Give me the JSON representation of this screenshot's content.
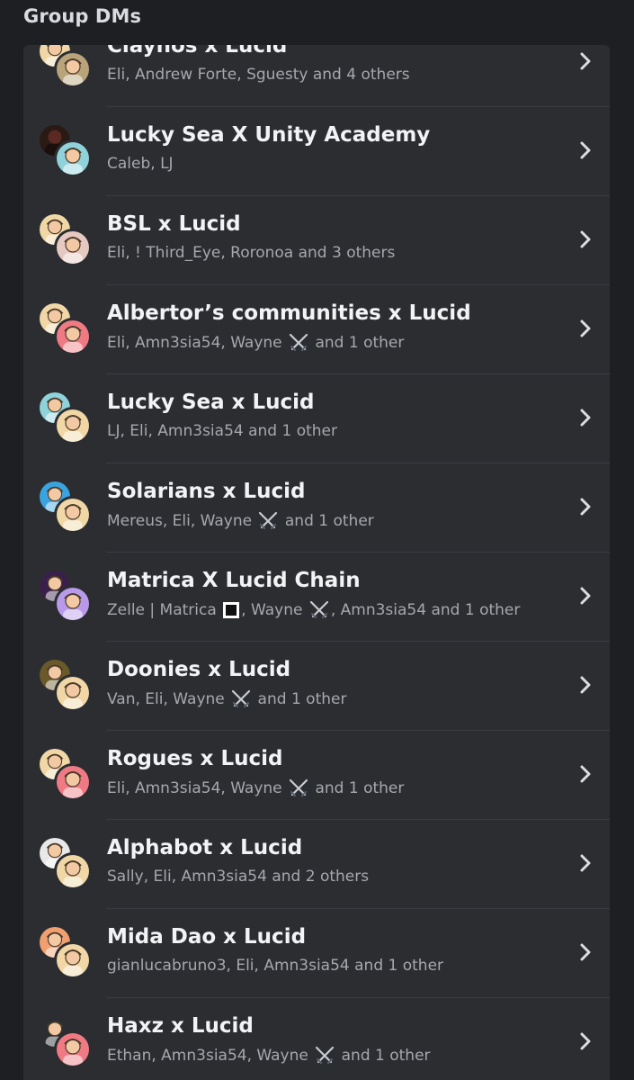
{
  "section_title": "Group DMs",
  "rows": [
    {
      "title": "Claynos x Lucid",
      "sub_parts": [
        "Eli, Andrew Forte, Sguesty and 4 others"
      ],
      "avatar_back": "#f0d7a5",
      "avatar_front": "#b8a37a",
      "avatar_back_icon": "person-sketch-icon",
      "avatar_front_icon": "bird-icon"
    },
    {
      "title": "Lucky Sea X Unity Academy",
      "sub_parts": [
        "Caleb, LJ"
      ],
      "avatar_back": "#2a1a14",
      "avatar_front": "#8fd2d9",
      "avatar_back_icon": "hooded-figure-icon",
      "avatar_front_icon": "parrot-icon"
    },
    {
      "title": "BSL x Lucid",
      "sub_parts": [
        "Eli, !  Third_Eye, Roronoa and 3 others"
      ],
      "avatar_back": "#f0d7a5",
      "avatar_front": "#e6c9c0",
      "avatar_back_icon": "person-sketch-icon",
      "avatar_front_icon": "warrior-icon"
    },
    {
      "title": "Albertor’s communities x Lucid",
      "sub_parts": [
        "Eli, Amn3sia54, Wayne ",
        "SWORD",
        " and 1 other"
      ],
      "avatar_back": "#f0d7a5",
      "avatar_front": "#f07a84",
      "avatar_back_icon": "person-sketch-icon",
      "avatar_front_icon": "pink-character-icon"
    },
    {
      "title": "Lucky Sea x Lucid",
      "sub_parts": [
        "LJ, Eli, Amn3sia54 and 1 other"
      ],
      "avatar_back": "#8fd2d9",
      "avatar_front": "#f0d7a5",
      "avatar_back_icon": "parrot-icon",
      "avatar_front_icon": "person-sketch-icon"
    },
    {
      "title": "Solarians x Lucid",
      "sub_parts": [
        "Mereus, Eli, Wayne ",
        "SWORD",
        " and 1 other"
      ],
      "avatar_back": "#3ba4e0",
      "avatar_front": "#f0d7a5",
      "avatar_back_icon": "robot-icon",
      "avatar_front_icon": "person-sketch-icon"
    },
    {
      "title": "Matrica X Lucid Chain",
      "sub_parts": [
        "Zelle | Matrica ",
        "SQUARE",
        ", Wayne ",
        "SWORD",
        ", Amn3sia54 and 1 other"
      ],
      "avatar_back": "#3a1f4a",
      "avatar_front": "#b89ae8",
      "avatar_back_icon": "brave-logo-icon",
      "avatar_front_icon": "purple-character-icon"
    },
    {
      "title": "Doonies x Lucid",
      "sub_parts": [
        "Van, Eli, Wayne ",
        "SWORD",
        " and 1 other"
      ],
      "avatar_back": "#6a5a2a",
      "avatar_front": "#f0d7a5",
      "avatar_back_icon": "skull-icon",
      "avatar_front_icon": "person-sketch-icon"
    },
    {
      "title": "Rogues x Lucid",
      "sub_parts": [
        "Eli, Amn3sia54, Wayne ",
        "SWORD",
        " and 1 other"
      ],
      "avatar_back": "#f0d7a5",
      "avatar_front": "#f07a84",
      "avatar_back_icon": "person-sketch-icon",
      "avatar_front_icon": "pink-character-icon"
    },
    {
      "title": "Alphabot x Lucid",
      "sub_parts": [
        "Sally, Eli, Amn3sia54 and 2 others"
      ],
      "avatar_back": "#e8e8e8",
      "avatar_front": "#f0d7a5",
      "avatar_back_icon": "blonde-person-icon",
      "avatar_front_icon": "person-sketch-icon"
    },
    {
      "title": "Mida Dao x Lucid",
      "sub_parts": [
        "gianlucabruno3, Eli, Amn3sia54 and 1 other"
      ],
      "avatar_back": "#f0a070",
      "avatar_front": "#f0d7a5",
      "avatar_back_icon": "pixel-character-icon",
      "avatar_front_icon": "person-sketch-icon"
    },
    {
      "title": "Haxz x Lucid",
      "sub_parts": [
        "Ethan, Amn3sia54, Wayne ",
        "SWORD",
        " and 1 other"
      ],
      "avatar_back": "#2b2d31",
      "avatar_front": "#f07a84",
      "avatar_back_icon": "colorful-bird-icon",
      "avatar_front_icon": "pink-character-icon"
    }
  ]
}
